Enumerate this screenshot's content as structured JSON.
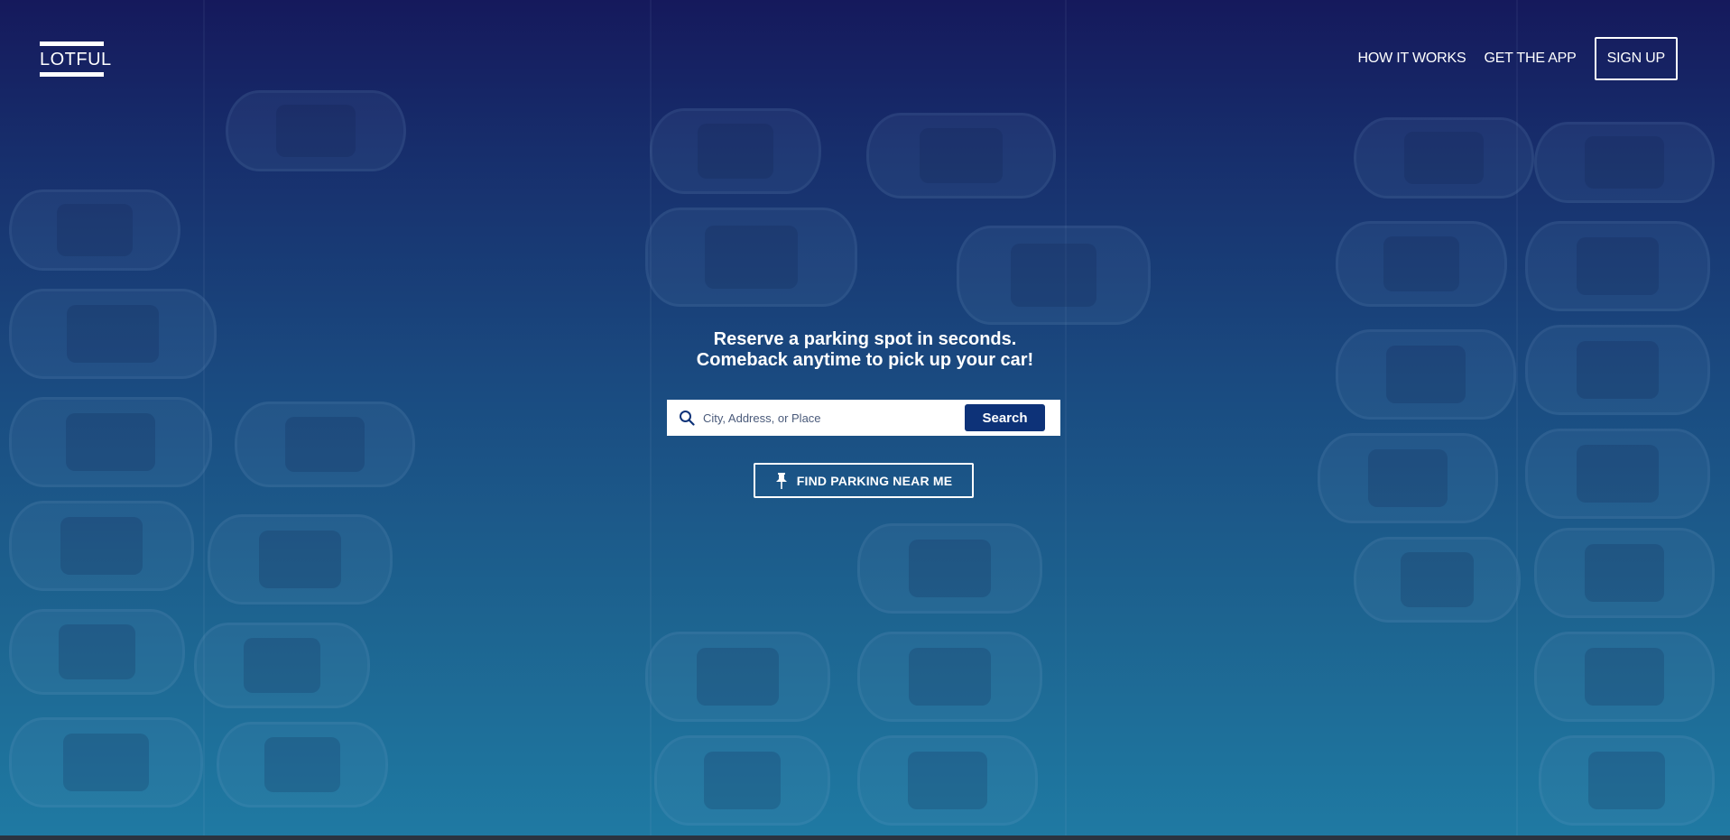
{
  "header": {
    "logo_text": "LOTFUL",
    "nav": {
      "how_it_works": "HOW IT WORKS",
      "get_the_app": "GET THE APP",
      "sign_up": "SIGN UP"
    }
  },
  "hero": {
    "headline_line1": "Reserve a parking spot in seconds.",
    "headline_line2": "Comeback anytime to pick up your car!",
    "search": {
      "placeholder": "City, Address, or Place",
      "value": "",
      "button_label": "Search"
    },
    "find_near_me_label": "FIND PARKING NEAR ME"
  },
  "icons": {
    "search": "search-icon",
    "pin": "pushpin-icon"
  },
  "colors": {
    "gradient_top": "#15195c",
    "gradient_bottom": "#1f7aa3",
    "search_button": "#0d3278",
    "text": "#ffffff"
  }
}
